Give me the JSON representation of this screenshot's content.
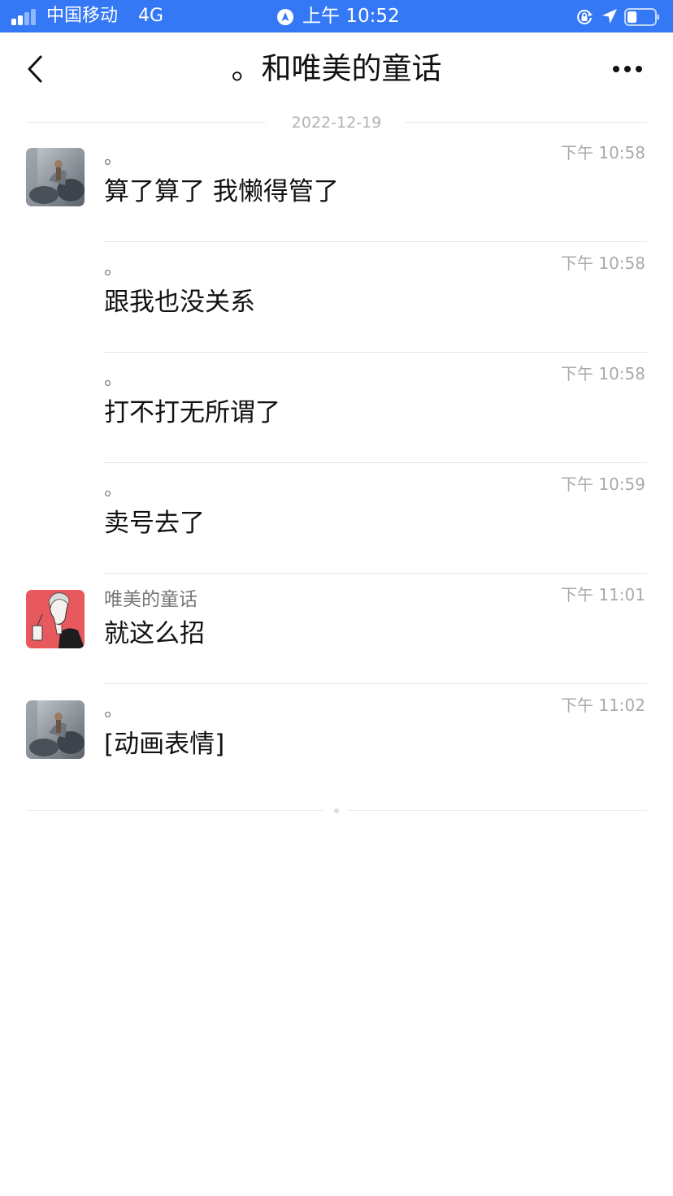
{
  "status_bar": {
    "carrier": "中国移动",
    "network": "4G",
    "time": "上午 10:52",
    "battery_level": 0.35,
    "color": "#3478f6"
  },
  "nav": {
    "title": "。和唯美的童话",
    "back_icon": "chevron-left-icon",
    "more_icon": "more-dots-icon"
  },
  "date_divider": "2022-12-19",
  "messages": [
    {
      "sender": "。",
      "time": "下午 10:58",
      "content": "算了算了 我懒得管了",
      "avatar": "avatar-user-1"
    },
    {
      "sender": "。",
      "time": "下午 10:58",
      "content": "跟我也没关系"
    },
    {
      "sender": "。",
      "time": "下午 10:58",
      "content": "打不打无所谓了"
    },
    {
      "sender": "。",
      "time": "下午 10:59",
      "content": "卖号去了"
    },
    {
      "sender": "唯美的童话",
      "time": "下午 11:01",
      "content": "就这么招",
      "avatar": "avatar-user-2"
    },
    {
      "sender": "。",
      "time": "下午 11:02",
      "content": "[动画表情]",
      "avatar": "avatar-user-1"
    }
  ]
}
